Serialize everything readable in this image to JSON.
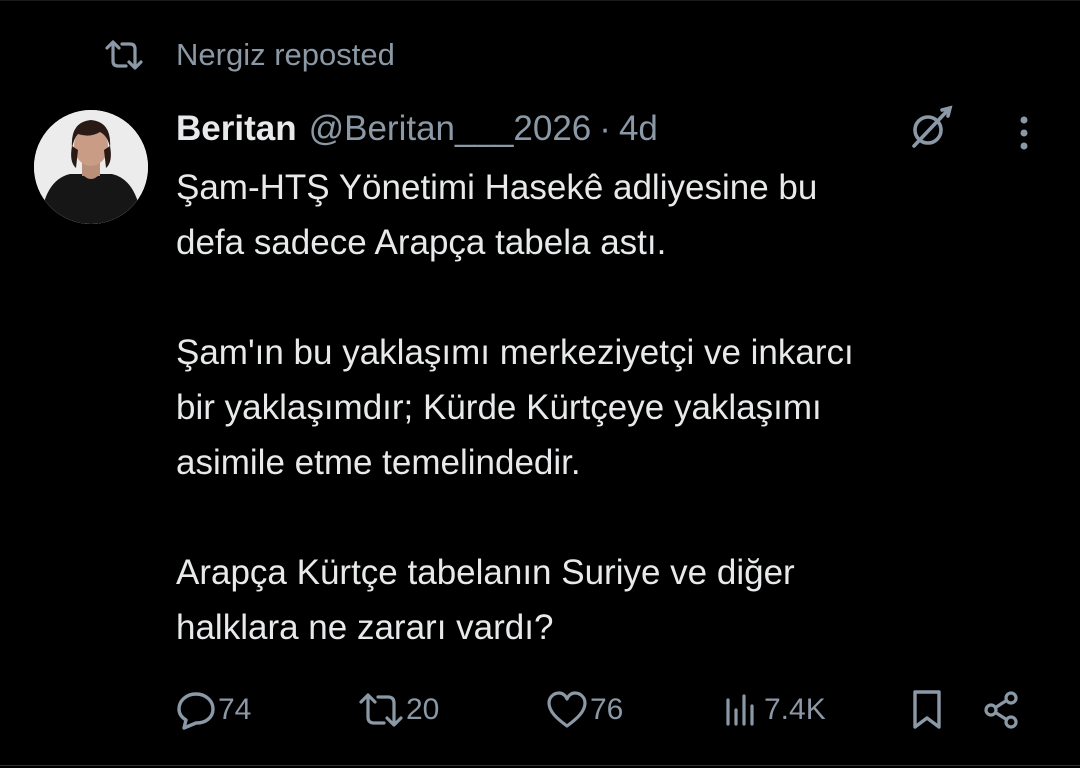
{
  "repost": {
    "label": "Nergiz reposted",
    "icon": "repost-icon"
  },
  "tweet": {
    "author_name": "Beritan",
    "author_handle": "@Beritan___2026",
    "separator": "·",
    "time": "4d",
    "paragraphs": [
      "Şam-HTŞ Yönetimi Hasekê adliyesine bu\ndefa sadece Arapça tabela astı.",
      "Şam'ın bu yaklaşımı merkeziyetçi ve inkarcı\nbir yaklaşımdır; Kürde Kürtçeye yaklaşımı\nasimile etme temelindedir.",
      "Arapça Kürtçe tabelanın Suriye ve diğer\nhalklara ne zararı vardı?"
    ]
  },
  "actions": {
    "replies": "74",
    "reposts": "20",
    "likes": "76",
    "views": "7.4K"
  },
  "colors": {
    "background": "#000000",
    "text_primary": "#e7e9ea",
    "text_secondary": "#8b98a5"
  }
}
